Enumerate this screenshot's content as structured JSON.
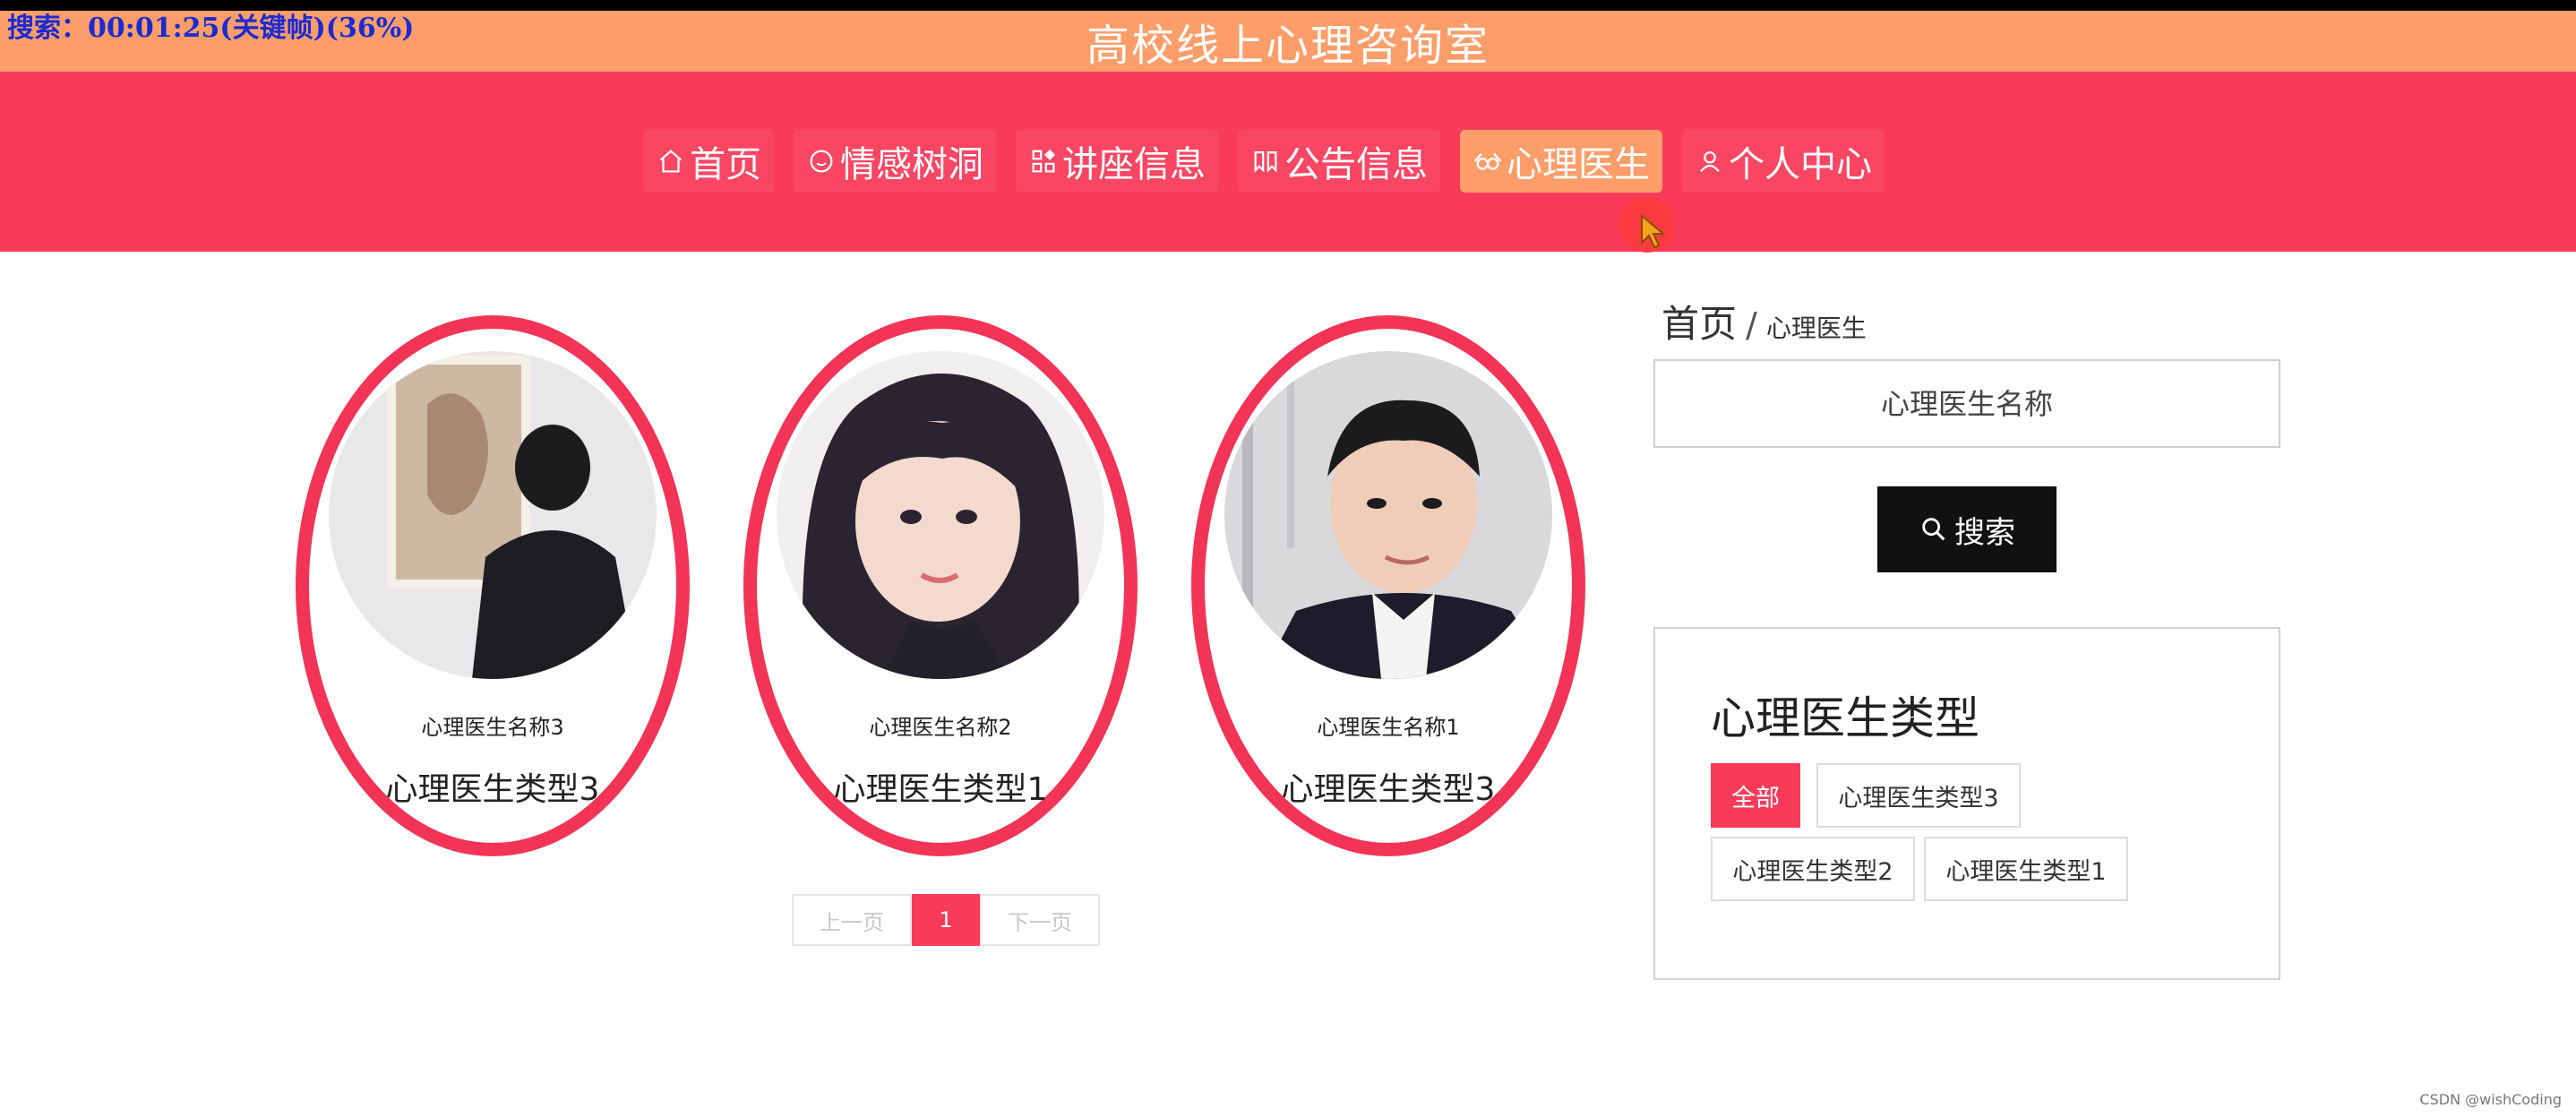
{
  "recording_overlay": "搜索：00:01:25(关键帧)(36%)",
  "site_title": "高校线上心理咨询室",
  "nav": {
    "items": [
      {
        "label": "首页",
        "icon": "home-icon"
      },
      {
        "label": "情感树洞",
        "icon": "smile-icon"
      },
      {
        "label": "讲座信息",
        "icon": "grid-icon"
      },
      {
        "label": "公告信息",
        "icon": "bookmark-icon"
      },
      {
        "label": "心理医生",
        "icon": "reader-icon",
        "active": true
      },
      {
        "label": "个人中心",
        "icon": "user-icon"
      }
    ]
  },
  "doctors": [
    {
      "name": "心理医生名称3",
      "type": "心理医生类型3"
    },
    {
      "name": "心理医生名称2",
      "type": "心理医生类型1"
    },
    {
      "name": "心理医生名称1",
      "type": "心理医生类型3"
    }
  ],
  "pagination": {
    "prev": "上一页",
    "current": "1",
    "next": "下一页"
  },
  "breadcrumb": {
    "home": "首页",
    "separator": "/",
    "current": "心理医生"
  },
  "search": {
    "placeholder": "心理医生名称",
    "button": "搜索"
  },
  "type_panel": {
    "title": "心理医生类型",
    "tags": [
      "全部",
      "心理医生类型3",
      "心理医生类型2",
      "心理医生类型1"
    ]
  },
  "watermark": "CSDN @wishCoding",
  "colors": {
    "primary": "#f93b5a",
    "accent": "#fd9e6a",
    "button_dark": "#111111"
  }
}
